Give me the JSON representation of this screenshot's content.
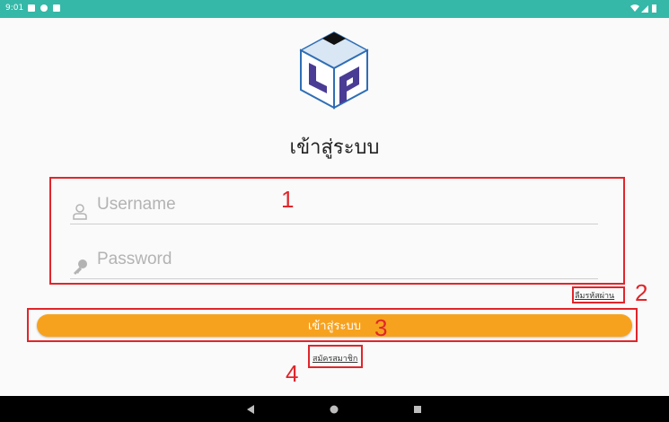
{
  "status_bar": {
    "time": "9:01"
  },
  "login": {
    "title": "เข้าสู่ระบบ",
    "username_placeholder": "Username",
    "password_placeholder": "Password",
    "forgot_password": "ลืมรหัสผ่าน",
    "login_button": "เข้าสู่ระบบ",
    "register_link": "สมัครสมาชิก"
  },
  "annotations": [
    "1",
    "2",
    "3",
    "4"
  ],
  "colors": {
    "status_bar": "#35b8a7",
    "accent": "#f7a21e",
    "annotation": "#e0262b",
    "logo_blue": "#2f6eb5",
    "logo_purple": "#4a3c95"
  },
  "icons": [
    "user-icon",
    "key-icon",
    "back-icon",
    "home-icon",
    "recents-icon"
  ]
}
